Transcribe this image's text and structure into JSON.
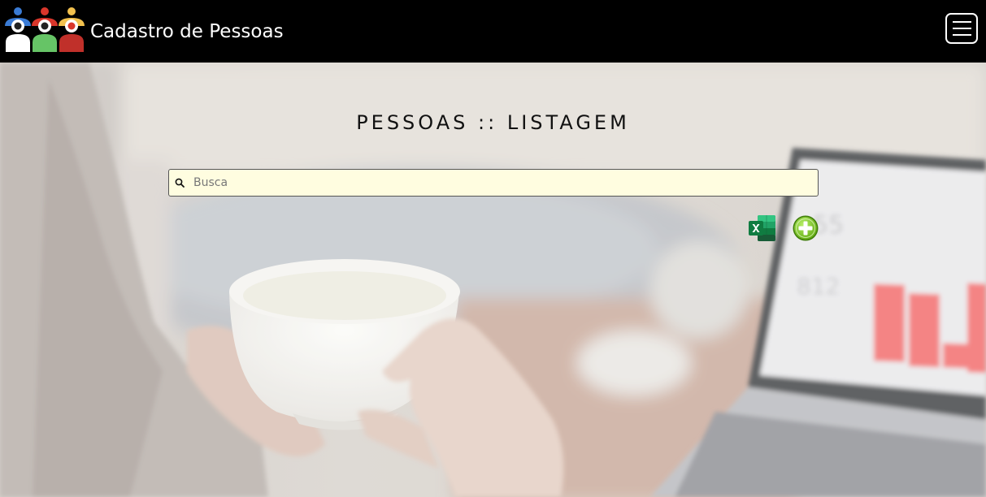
{
  "navbar": {
    "brand_title": "Cadastro de Pessoas",
    "logo_icon": "people-group-icon",
    "menu_icon": "hamburger-menu-icon"
  },
  "main": {
    "page_title": "PESSOAS :: LISTAGEM",
    "search": {
      "placeholder": "Busca",
      "value": "",
      "icon": "search-icon"
    },
    "actions": {
      "export_excel_icon": "excel-icon",
      "add_icon": "plus-circle-icon"
    }
  },
  "colors": {
    "navbar_bg": "#000000",
    "search_bg": "#fffde0",
    "add_green": "#7cc41f",
    "excel_green": "#1d6f42",
    "logo_blue": "#3a7bd5",
    "logo_green": "#66c466",
    "logo_red": "#d9362b",
    "logo_yellow": "#f2c14e"
  }
}
